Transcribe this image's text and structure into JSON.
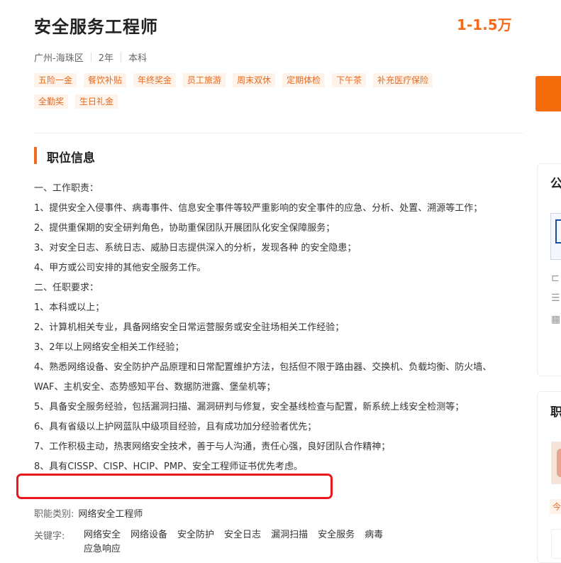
{
  "job": {
    "title": "安全服务工程师",
    "salary": "1-1.5万",
    "location": "广州-海珠区",
    "experience": "2年",
    "education": "本科",
    "tags": [
      "五险一金",
      "餐饮补贴",
      "年终奖金",
      "员工旅游",
      "周末双休",
      "定期体检",
      "下午茶",
      "补充医疗保险",
      "全勤奖",
      "生日礼金"
    ]
  },
  "section": {
    "title": "职位信息"
  },
  "description": [
    "一、工作职责：",
    "1、提供安全入侵事件、病毒事件、信息安全事件等较严重影响的安全事件的应急、分析、处置、溯源等工作；",
    "2、提供重保期的安全研判角色，协助重保团队开展团队化安全保障服务；",
    "3、对安全日志、系统日志、威胁日志提供深入的分析，发现各种 的安全隐患；",
    "4、甲方或公司安排的其他安全服务工作。",
    "二、任职要求：",
    "1、本科或以上；",
    "2、计算机相关专业，具备网络安全日常运营服务或安全驻场相关工作经验；",
    "3、2年以上网络安全相关工作经验；",
    "4、熟悉网络设备、安全防护产品原理和日常配置维护方法，包括但不限于路由器、交换机、负载均衡、防火墙、WAF、主机安全、态势感知平台、数据防泄露、堡垒机等；",
    "5、具备安全服务经验，包括漏洞扫描、漏洞研判与修复，安全基线检查与配置，新系统上线安全检测等；",
    "6、具有省级以上护网蓝队中级项目经验，且有成功加分经验者优先；",
    "7、工作积极主动，热衷网络安全技术，善于与人沟通，责任心强，良好团队合作精神；",
    "8、具有CISSP、CISP、HCIP、PMP、安全工程师证书优先考虑。"
  ],
  "function": {
    "label": "职能类别:",
    "value": "网络安全工程师"
  },
  "keywords": {
    "label": "关键字:",
    "items": [
      "网络安全",
      "网络设备",
      "安全防护",
      "安全日志",
      "漏洞扫描",
      "安全服务",
      "病毒",
      "应急响应"
    ]
  },
  "sidebar": {
    "company_title": "公",
    "related_title": "职",
    "related_tag": "今"
  },
  "colors": {
    "accent": "#f26b1d",
    "highlight": "#e8181c",
    "tag_bg": "#fff3ea"
  }
}
